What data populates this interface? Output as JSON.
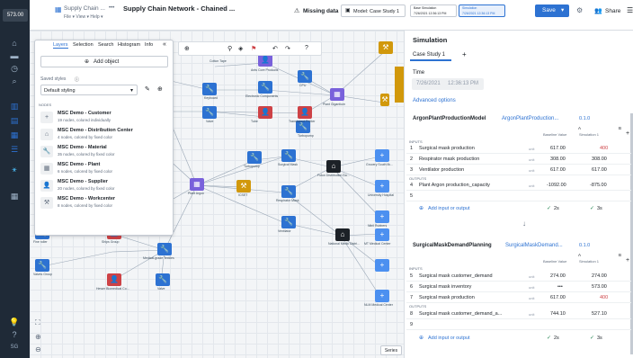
{
  "app": {
    "id_badge": "573.00",
    "breadcrumb": "Supply Chain ...",
    "sep": "•••",
    "title": "Supply Chain Network - Chained ...",
    "menus": "File ▾  View ▾  Help ▾",
    "sub_breadcrumb": "Supply Chain Resiliency Graph  >  View sub-graph",
    "missing_data": "Missing data",
    "model_label": "Model: Case Study 1",
    "base_sim_label": "Base Simulation",
    "base_sim_date": "7/26/2021 12:36:13 PM",
    "sim_label": "Simulation",
    "sim_date": "7/26/2021 12:36:13 PM",
    "save": "Save",
    "share": "Share"
  },
  "colors": {
    "accent": "#2d72d2",
    "rail": "#1f2a37",
    "red": "#cd4246",
    "purple": "#7961db",
    "orange": "#d1980b",
    "green": "#238551"
  },
  "layers": {
    "tabs": [
      "Layers",
      "Selection",
      "Search",
      "Histogram",
      "Info"
    ],
    "add": "Add object",
    "saved_label": "Saved styles",
    "saved_value": "Default styling",
    "nodes_header": "NODES",
    "items": [
      {
        "title": "MSC Demo - Customer",
        "sub": "19 nodes, colored individually",
        "icon": "+"
      },
      {
        "title": "MSC Demo - Distribution Center",
        "sub": "4 nodes, colored by fixed color",
        "icon": "⌂"
      },
      {
        "title": "MSC Demo - Material",
        "sub": "35 nodes, colored by fixed color",
        "icon": "🔧"
      },
      {
        "title": "MSC Demo - Plant",
        "sub": "6 nodes, colored by fixed color",
        "icon": "▦"
      },
      {
        "title": "MSC Demo - Supplier",
        "sub": "20 nodes, colored by fixed color",
        "icon": "👤"
      },
      {
        "title": "MSC Demo - Workcenter",
        "sub": "8 nodes, colored by fixed color",
        "icon": "⚒"
      }
    ]
  },
  "canvas": {
    "series": "Series",
    "labels": [
      "Cotton Tape",
      "Ants Core Products",
      "CPU",
      "Keyboard",
      "Electronic Components",
      "Translucent Printer",
      "Plant Gigantium",
      "Valve",
      "Medical Disp",
      "Tube",
      "Turbopump",
      "Surgical Mask",
      "Plant Argon",
      "ICSET",
      "Respirator Mask",
      "Futon Distribution Sa...",
      "University Hospital",
      "Ventilator",
      "Nitril Rubbers",
      "Ships Group",
      "Medical-grade Textiles",
      "Fine roller",
      "Hewer Biomedical Co...",
      "Valve",
      "National Medic Distri...",
      "MT Medical Center",
      "NLM Medical Center",
      "Valves Group",
      "Grocery South Ilk..."
    ]
  },
  "sim": {
    "title": "Simulation",
    "tab": "Case Study 1",
    "time_label": "Time",
    "date": "7/26/2021",
    "clock": "12:36:13 PM",
    "advanced": "Advanced options",
    "model1": {
      "name": "ArgonPlantProductionModel",
      "link": "ArgonPlantProduction...",
      "ver": "0.1.0",
      "col_a": "A",
      "col_b": "B",
      "base_hdr": "Baseline Value",
      "sim_hdr": "Simulation 1",
      "inputs": "INPUTS",
      "outputs": "OUTPUTS",
      "rows": [
        {
          "n": "1",
          "name": "Surgical mask production",
          "unit": "unit",
          "base": "617.00",
          "sim": "400"
        },
        {
          "n": "2",
          "name": "Respirator mask production",
          "unit": "unit",
          "base": "308.00",
          "sim": "308.00"
        },
        {
          "n": "3",
          "name": "Ventilator production",
          "unit": "unit",
          "base": "617.00",
          "sim": "617.00"
        },
        {
          "n": "4",
          "name": "Plant Argon production_capacity",
          "unit": "unit",
          "base": "-1092.00",
          "sim": "-875.00"
        },
        {
          "n": "5",
          "name": "",
          "unit": "",
          "base": "",
          "sim": ""
        }
      ],
      "add": "Add input or output",
      "t1": "2s",
      "t2": "3s"
    },
    "model2": {
      "name": "SurgicalMaskDemandPlanning",
      "link": "SurgicalMaskDemand...",
      "ver": "0.1.0",
      "col_a": "A",
      "col_b": "B",
      "base_hdr": "Baseline Value",
      "sim_hdr": "Simulation 1",
      "inputs": "INPUTS",
      "outputs": "OUTPUTS",
      "rows": [
        {
          "n": "5",
          "name": "Surgical mask customer_demand",
          "unit": "unit",
          "base": "274.00",
          "sim": "274.00"
        },
        {
          "n": "6",
          "name": "Surgical mask inventory",
          "unit": "unit",
          "base": "•••",
          "sim": "573.00"
        },
        {
          "n": "7",
          "name": "Surgical mask production",
          "unit": "unit",
          "base": "617.00",
          "sim": "400"
        },
        {
          "n": "8",
          "name": "Surgical mask customer_demand_a...",
          "unit": "unit",
          "base": "744.10",
          "sim": "527.10"
        },
        {
          "n": "9",
          "name": "",
          "unit": "",
          "base": "",
          "sim": ""
        }
      ],
      "add": "Add input or output",
      "t1": "2s",
      "t2": "3s"
    }
  }
}
